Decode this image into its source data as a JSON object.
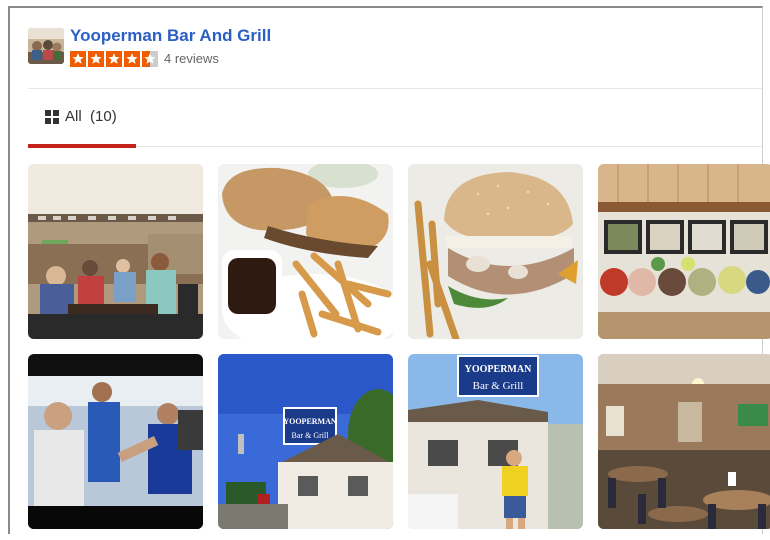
{
  "business": {
    "name": "Yooperman Bar And Grill",
    "rating": 4.5,
    "rating_color": "#f15c00",
    "review_count_text": "4 reviews"
  },
  "tabs": [
    {
      "label": "All",
      "count": "(10)",
      "active": true
    }
  ],
  "colors": {
    "link": "#2b5fc4",
    "active_tab_underline": "#c4221a"
  },
  "photos": [
    {
      "name": "photo-bar-interior-crowd"
    },
    {
      "name": "photo-sandwich-fries-au-jus"
    },
    {
      "name": "photo-burger-and-fries"
    },
    {
      "name": "photo-salad-bar"
    },
    {
      "name": "photo-tv-screen-celebration"
    },
    {
      "name": "photo-bar-exterior-sign"
    },
    {
      "name": "photo-man-in-front-of-bar"
    },
    {
      "name": "photo-dining-room"
    }
  ],
  "signs": {
    "exterior_sign_line1": "YOOPERMAN",
    "exterior_sign_line2": "Bar & Grill"
  }
}
